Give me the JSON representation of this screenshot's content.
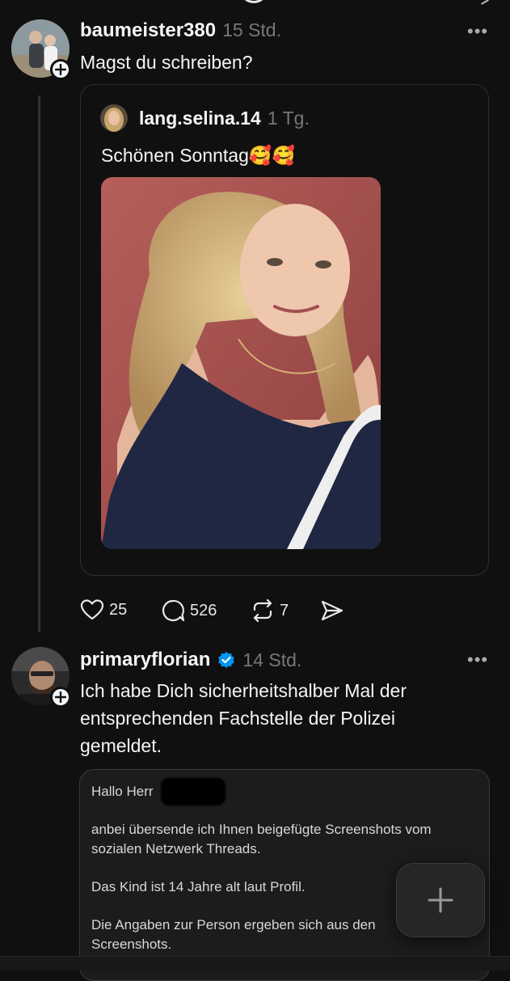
{
  "post1": {
    "username": "baumeister380",
    "time": "15 Std.",
    "more": "•••",
    "text": "Magst du  schreiben?",
    "quote": {
      "username": "lang.selina.14",
      "time": "1 Tg.",
      "text": "Schönen Sonntag🥰🥰"
    },
    "actions": {
      "likes": "25",
      "replies": "526",
      "reposts": "7"
    }
  },
  "post2": {
    "username": "primaryflorian",
    "time": "14 Std.",
    "more": "•••",
    "text_lines": [
      "Ich habe Dich sicherheitshalber Mal der",
      "entsprechenden Fachstelle der Polizei",
      "gemeldet."
    ],
    "email": {
      "greeting": "Hallo Herr",
      "p1_l1": "anbei übersende ich Ihnen beigefügte Screenshots vom",
      "p1_l2": "sozialen Netzwerk Threads.",
      "p2": "Das Kind ist 14 Jahre alt laut Profil.",
      "p3_l1": "Die Angaben zur Person ergeben sich aus den",
      "p3_l2": "Screenshots."
    }
  },
  "colors": {
    "background": "#101010",
    "text": "#f3f5f7",
    "muted": "#777777",
    "verified": "#0095f6"
  }
}
